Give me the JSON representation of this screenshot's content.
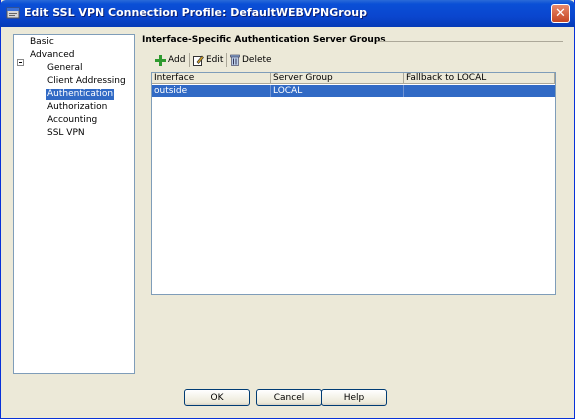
{
  "window": {
    "title": "Edit SSL VPN Connection Profile: DefaultWEBVPNGroup",
    "close_symbol": "✕"
  },
  "nav": {
    "items": [
      {
        "label": "Basic",
        "level": 0
      },
      {
        "label": "Advanced",
        "level": 0,
        "expanded": true
      },
      {
        "label": "General",
        "level": 1
      },
      {
        "label": "Client Addressing",
        "level": 1
      },
      {
        "label": "Authentication",
        "level": 1,
        "selected": true
      },
      {
        "label": "Authorization",
        "level": 1
      },
      {
        "label": "Accounting",
        "level": 1
      },
      {
        "label": "SSL VPN",
        "level": 1
      }
    ]
  },
  "group": {
    "title": "Interface-Specific Authentication Server Groups"
  },
  "toolbar": {
    "add_label": "Add",
    "edit_label": "Edit",
    "delete_label": "Delete"
  },
  "table": {
    "columns": [
      "Interface",
      "Server Group",
      "Fallback to LOCAL"
    ],
    "rows": [
      {
        "interface": "outside",
        "server_group": "LOCAL",
        "fallback": "",
        "selected": true
      }
    ]
  },
  "buttons": {
    "ok": "OK",
    "cancel": "Cancel",
    "help": "Help"
  },
  "colors": {
    "selection": "#316ac5",
    "titlebar": "#0a46cf"
  }
}
